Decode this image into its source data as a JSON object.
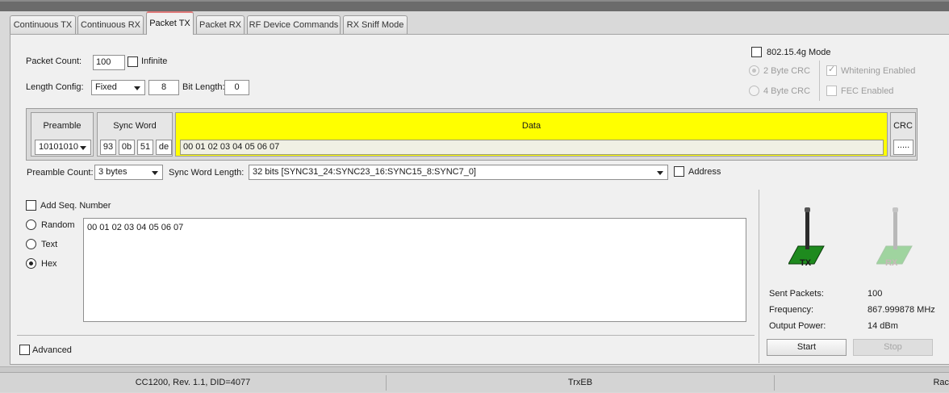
{
  "tabs": [
    {
      "label": "Continuous TX"
    },
    {
      "label": "Continuous RX"
    },
    {
      "label": "Packet TX"
    },
    {
      "label": "Packet RX"
    },
    {
      "label": "RF Device Commands"
    },
    {
      "label": "RX Sniff Mode"
    }
  ],
  "packet": {
    "count_label": "Packet Count:",
    "count_value": "100",
    "infinite_label": "Infinite",
    "length_config_label": "Length Config:",
    "length_config_value": "Fixed",
    "length_value": "8",
    "bit_length_label": "Bit Length:",
    "bit_length_value": "0"
  },
  "ieee": {
    "mode_label": "802.15.4g Mode",
    "crc2_label": "2 Byte CRC",
    "crc4_label": "4 Byte CRC",
    "whitening_label": "Whitening Enabled",
    "fec_label": "FEC Enabled"
  },
  "fields": {
    "preamble_title": "Preamble",
    "preamble_value": "10101010",
    "sync_title": "Sync Word",
    "sync_bytes": [
      "93",
      "0b",
      "51",
      "de"
    ],
    "data_title": "Data",
    "data_value": "00 01 02 03 04 05 06 07",
    "crc_title": "CRC",
    "crc_value": "....."
  },
  "options": {
    "preamble_count_label": "Preamble Count:",
    "preamble_count_value": "3 bytes",
    "sync_length_label": "Sync Word Length:",
    "sync_length_value": "32 bits [SYNC31_24:SYNC23_16:SYNC15_8:SYNC7_0]",
    "address_label": "Address"
  },
  "payload": {
    "add_seq_label": "Add Seq. Number",
    "random_label": "Random",
    "text_label": "Text",
    "hex_label": "Hex",
    "selected_mode": "Hex",
    "text_value": "00 01 02 03 04 05 06 07"
  },
  "advanced_label": "Advanced",
  "indicators": {
    "tx_label": "TX",
    "rx_label": "RX",
    "tx_color": "#1e8a1e",
    "rx_color": "#9fd49f"
  },
  "stats": [
    {
      "label": "Sent Packets:",
      "value": "100"
    },
    {
      "label": "Frequency:",
      "value": "867.999878 MHz"
    },
    {
      "label": "Output Power:",
      "value": "14 dBm"
    }
  ],
  "buttons": {
    "start": "Start",
    "stop": "Stop"
  },
  "status": {
    "device": "CC1200, Rev. 1.1, DID=4077",
    "board": "TrxEB",
    "right": "Rac"
  }
}
